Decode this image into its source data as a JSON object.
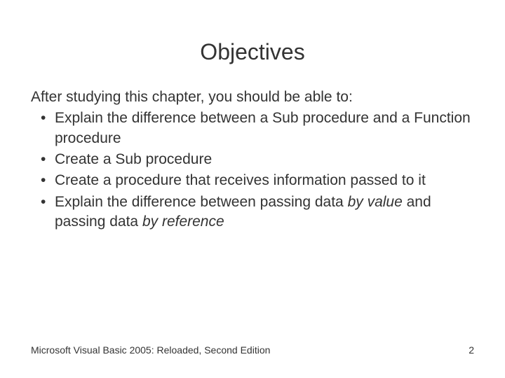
{
  "title": "Objectives",
  "intro": "After studying this chapter, you should be able to:",
  "bullets": [
    {
      "pre": "Explain the difference between a Sub procedure and a Function procedure",
      "em1": "",
      "mid": "",
      "em2": "",
      "post": ""
    },
    {
      "pre": "Create a Sub procedure",
      "em1": "",
      "mid": "",
      "em2": "",
      "post": ""
    },
    {
      "pre": "Create a procedure that receives information passed to it",
      "em1": "",
      "mid": "",
      "em2": "",
      "post": ""
    },
    {
      "pre": "Explain the difference between passing data ",
      "em1": "by value",
      "mid": " and passing data ",
      "em2": "by reference",
      "post": ""
    }
  ],
  "footer": {
    "left": "Microsoft Visual Basic 2005: Reloaded, Second Edition",
    "right": "2"
  }
}
